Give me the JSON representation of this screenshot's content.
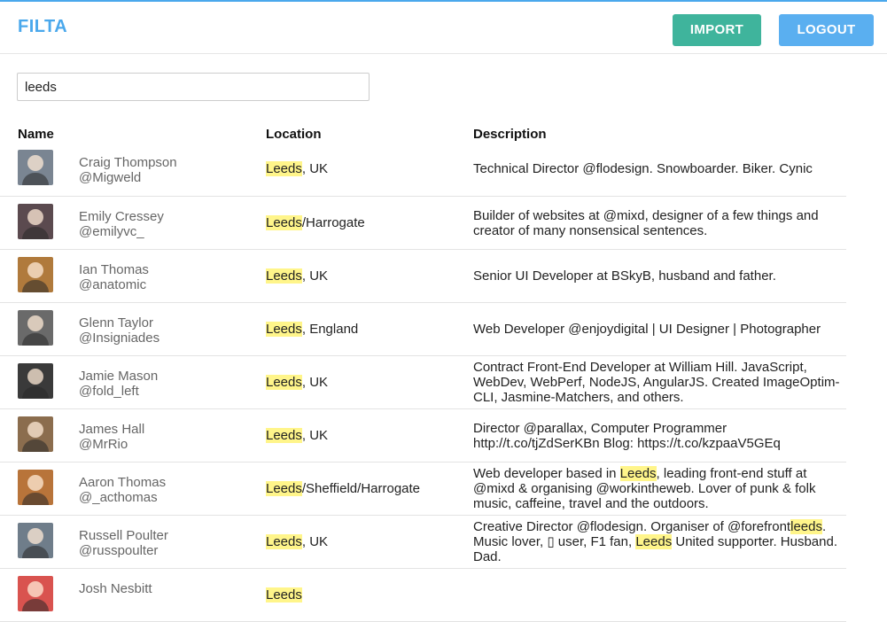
{
  "brand": "FILTA",
  "buttons": {
    "import": "IMPORT",
    "logout": "LOGOUT"
  },
  "colors": {
    "accent": "#4aa8ec",
    "import": "#3fb49c",
    "logout": "#5aaff0",
    "highlight": "#fff58a"
  },
  "search": {
    "value": "leeds",
    "highlight": "leeds"
  },
  "columns": {
    "name": "Name",
    "location": "Location",
    "description": "Description"
  },
  "rows": [
    {
      "name": "Craig Thompson",
      "handle": "@Migweld",
      "location": "Leeds, UK",
      "description": "Technical Director @flodesign. Snowboarder. Biker. Cynic",
      "avatar_color": "#7a8592"
    },
    {
      "name": "Emily Cressey",
      "handle": "@emilyvc_",
      "location": "Leeds/Harrogate",
      "description": "Builder of websites at @mixd, designer of a few things and creator of many nonsensical sentences.",
      "avatar_color": "#5b4a4f"
    },
    {
      "name": "Ian Thomas",
      "handle": "@anatomic",
      "location": "Leeds, UK",
      "description": "Senior UI Developer at BSkyB, husband and father.",
      "avatar_color": "#b07a3c"
    },
    {
      "name": "Glenn Taylor",
      "handle": "@Insigniades",
      "location": "Leeds, England",
      "description": "Web Developer @enjoydigital | UI Designer | Photographer",
      "avatar_color": "#6a6a6a"
    },
    {
      "name": "Jamie Mason",
      "handle": "@fold_left",
      "location": "Leeds, UK",
      "description": "Contract Front-End Developer at William Hill. JavaScript, WebDev, WebPerf, NodeJS, AngularJS. Created ImageOptim-CLI, Jasmine-Matchers, and others.",
      "avatar_color": "#3a3a3a"
    },
    {
      "name": "James Hall",
      "handle": "@MrRio",
      "location": "Leeds, UK",
      "description": "Director @parallax, Computer Programmer http://t.co/tjZdSerKBn Blog: https://t.co/kzpaaV5GEq",
      "avatar_color": "#8b6d4e"
    },
    {
      "name": "Aaron Thomas",
      "handle": "@_acthomas",
      "location": "Leeds/Sheffield/Harrogate",
      "description": "Web developer based in Leeds, leading front-end stuff at @mixd & organising @workintheweb. Lover of punk & folk music, caffeine, travel and the outdoors.",
      "avatar_color": "#b8743a"
    },
    {
      "name": "Russell Poulter",
      "handle": "@russpoulter",
      "location": "Leeds, UK",
      "description": "Creative Director @flodesign. Organiser of @forefrontleeds. Music lover, ▯ user, F1 fan, Leeds United supporter. Husband. Dad.",
      "avatar_color": "#6f7d8a"
    },
    {
      "name": "Josh Nesbitt",
      "handle": "",
      "location": "Leeds",
      "description": "",
      "avatar_color": "#d9534f"
    }
  ]
}
